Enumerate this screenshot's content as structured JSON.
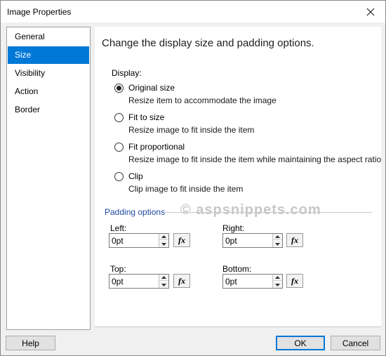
{
  "window": {
    "title": "Image Properties"
  },
  "nav": {
    "items": [
      {
        "label": "General",
        "selected": false
      },
      {
        "label": "Size",
        "selected": true
      },
      {
        "label": "Visibility",
        "selected": false
      },
      {
        "label": "Action",
        "selected": false
      },
      {
        "label": "Border",
        "selected": false
      }
    ]
  },
  "main": {
    "heading": "Change the display size and padding options.",
    "display_label": "Display:",
    "options": [
      {
        "label": "Original size",
        "description": "Resize item to accommodate the image",
        "checked": true
      },
      {
        "label": "Fit to size",
        "description": "Resize image to fit inside the item",
        "checked": false
      },
      {
        "label": "Fit proportional",
        "description": "Resize image to fit inside the item while maintaining the aspect ratio",
        "checked": false
      },
      {
        "label": "Clip",
        "description": "Clip image to fit inside the item",
        "checked": false
      }
    ],
    "padding": {
      "legend": "Padding options",
      "left": {
        "label": "Left:",
        "value": "0pt"
      },
      "right": {
        "label": "Right:",
        "value": "0pt"
      },
      "top": {
        "label": "Top:",
        "value": "0pt"
      },
      "bottom": {
        "label": "Bottom:",
        "value": "0pt"
      },
      "fx_label": "fx"
    },
    "watermark": "© aspsnippets.com"
  },
  "footer": {
    "help_label": "Help",
    "ok_label": "OK",
    "cancel_label": "Cancel"
  },
  "colors": {
    "selection": "#0078d7",
    "legend": "#1f4aa0",
    "watermark": "#c8c8c8"
  },
  "icons": {
    "close": "close-icon",
    "spin_up": "spin-up-arrow-icon",
    "spin_down": "spin-down-arrow-icon"
  }
}
